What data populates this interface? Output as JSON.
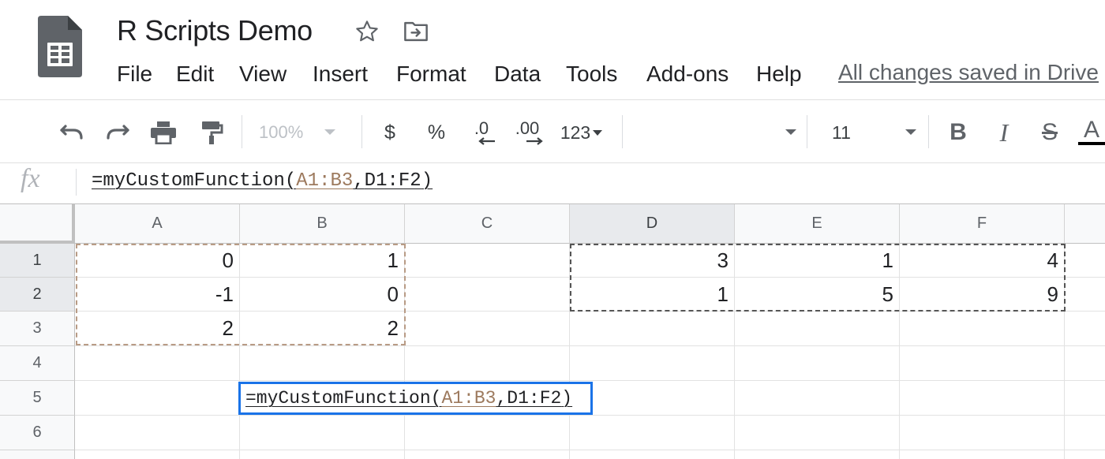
{
  "document": {
    "title": "R Scripts Demo",
    "save_status": "All changes saved in Drive"
  },
  "header_icons": [
    "star-icon",
    "move-to-folder-icon"
  ],
  "menu": [
    "File",
    "Edit",
    "View",
    "Insert",
    "Format",
    "Data",
    "Tools",
    "Add-ons",
    "Help"
  ],
  "toolbar": {
    "zoom": "100%",
    "currency_label": "$",
    "percent_label": "%",
    "decrease_decimal_label": ".0",
    "increase_decimal_label": ".00",
    "more_formats_label": "123",
    "font_name": "",
    "font_size": "11",
    "bold_label": "B",
    "italic_label": "I",
    "strikethrough_label": "S",
    "text_color_label": "A"
  },
  "formula_bar": {
    "fx_label": "fx",
    "formula": {
      "prefix": "=myCustomFunction(",
      "ref1": "A1:B3",
      "comma": ",",
      "ref2": "D1:F2",
      "suffix": ")"
    }
  },
  "grid": {
    "columns": [
      "A",
      "B",
      "C",
      "D",
      "E",
      "F"
    ],
    "rows": [
      "1",
      "2",
      "3",
      "4",
      "5",
      "6"
    ],
    "cells": [
      [
        "0",
        "1",
        "",
        "3",
        "1",
        "4"
      ],
      [
        "-1",
        "0",
        "",
        "1",
        "5",
        "9"
      ],
      [
        "2",
        "2",
        "",
        "",
        "",
        ""
      ],
      [
        "",
        "",
        "",
        "",
        "",
        ""
      ],
      [
        "",
        "",
        "",
        "",
        "",
        ""
      ],
      [
        "",
        "",
        "",
        "",
        "",
        ""
      ]
    ],
    "editing_cell": "B5",
    "editor_formula": {
      "prefix": "=myCustomFunction(",
      "ref1": "A1:B3",
      "comma": ",",
      "ref2": "D1:F2",
      "suffix": ")"
    }
  },
  "colors": {
    "range1": "#b89b85",
    "range2": "#555555",
    "active_cell": "#1a73e8",
    "sheets_green": "#5f6368"
  }
}
